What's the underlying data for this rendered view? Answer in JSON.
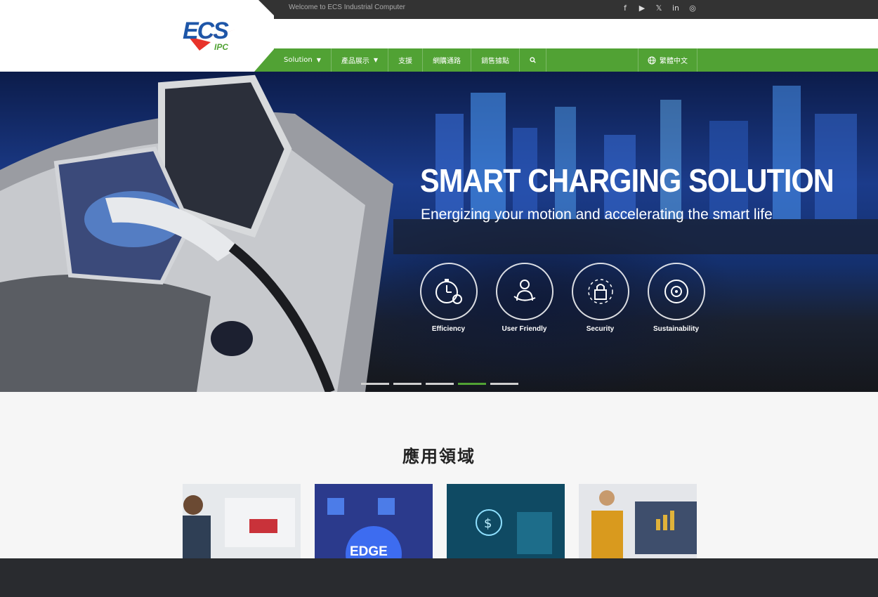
{
  "topbar": {
    "welcome": "Welcome to ECS Industrial Computer",
    "social": [
      "f",
      "▶",
      "𝕏",
      "in",
      "◎"
    ]
  },
  "logo": {
    "brand": "ECS",
    "sub": "IPC"
  },
  "nav": {
    "items": [
      "Solution",
      "產品展示",
      "支援",
      "網購通路",
      "銷售據點"
    ],
    "language": "繁體中文"
  },
  "hero": {
    "title": "SMART CHARGING SOLUTION",
    "subtitle": "Energizing your motion and accelerating the smart life",
    "features": [
      "Efficiency",
      "User Friendly",
      "Security",
      "Sustainability"
    ],
    "slides_total": 5,
    "active_slide": 4
  },
  "section": {
    "title": "應用領域",
    "card_edge_label": "EDGE"
  },
  "colors": {
    "accent": "#51a234",
    "topbar": "#333333",
    "footer": "#292b2f"
  }
}
